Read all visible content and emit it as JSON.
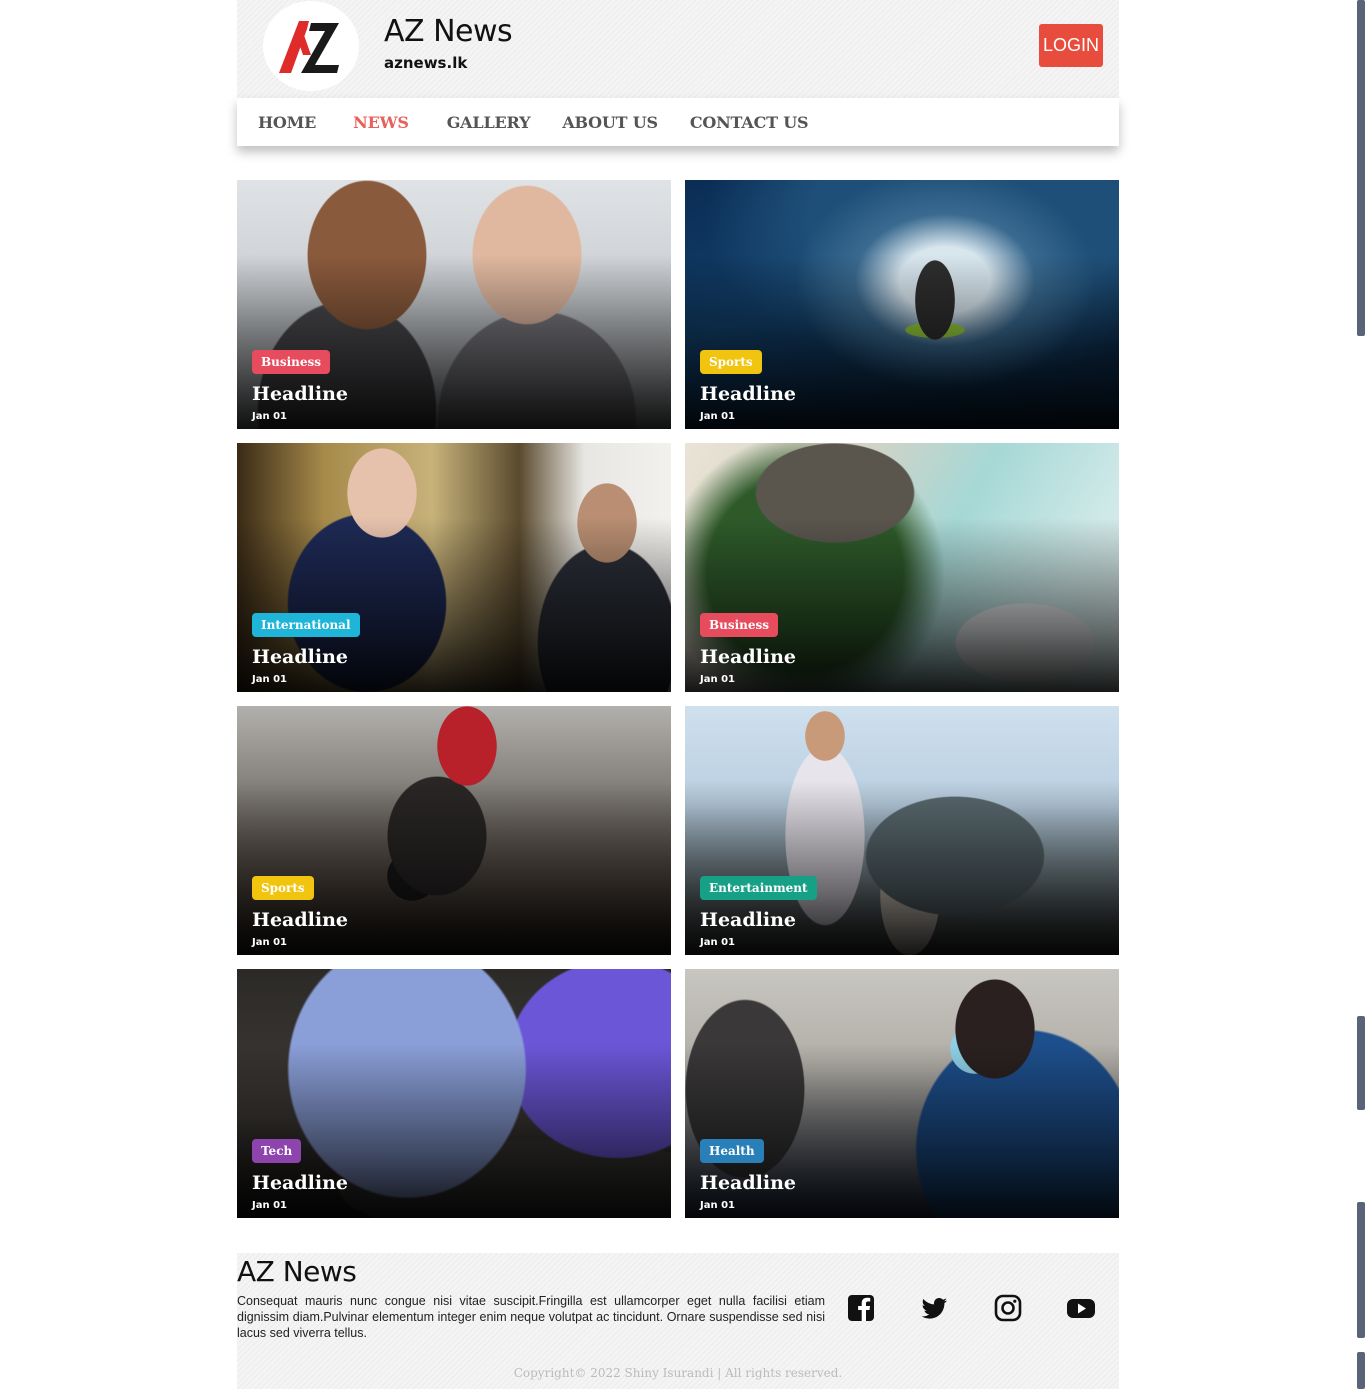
{
  "header": {
    "brand_title": "AZ News",
    "brand_domain": "aznews.lk",
    "login_label": "LOGIN",
    "logo_icon": "az-logo-icon"
  },
  "nav": {
    "items": [
      {
        "label": "HOME"
      },
      {
        "label": "NEWS",
        "active": true
      },
      {
        "label": "GALLERY"
      },
      {
        "label": "ABOUT US"
      },
      {
        "label": "CONTACT US"
      }
    ]
  },
  "cards": [
    {
      "category": "Business",
      "category_color": "#e74c5e",
      "headline": "Headline",
      "date": "Jan 01"
    },
    {
      "category": "Sports",
      "category_color": "#f1c40f",
      "headline": "Headline",
      "date": "Jan 01"
    },
    {
      "category": "International",
      "category_color": "#1fb5d8",
      "headline": "Headline",
      "date": "Jan 01"
    },
    {
      "category": "Business",
      "category_color": "#e74c5e",
      "headline": "Headline",
      "date": "Jan 01"
    },
    {
      "category": "Sports",
      "category_color": "#f1c40f",
      "headline": "Headline",
      "date": "Jan 01"
    },
    {
      "category": "Entertainment",
      "category_color": "#16a085",
      "headline": "Headline",
      "date": "Jan 01"
    },
    {
      "category": "Tech",
      "category_color": "#8e44ad",
      "headline": "Headline",
      "date": "Jan 01"
    },
    {
      "category": "Health",
      "category_color": "#2980b9",
      "headline": "Headline",
      "date": "Jan 01"
    }
  ],
  "footer": {
    "title": "AZ News",
    "description": "Consequat mauris nunc congue nisi vitae suscipit.Fringilla est ullamcorper eget nulla facilisi etiam dignissim diam.Pulvinar elementum integer enim neque volutpat ac tincidunt. Ornare suspendisse sed nisi lacus sed viverra tellus.",
    "social": [
      "facebook-icon",
      "twitter-icon",
      "instagram-icon",
      "youtube-icon"
    ],
    "copyright": "Copyright© 2022 Shiny Isurandi | All rights reserved."
  },
  "colors": {
    "accent": "#e74c3c",
    "nav_active": "#e8605a"
  }
}
